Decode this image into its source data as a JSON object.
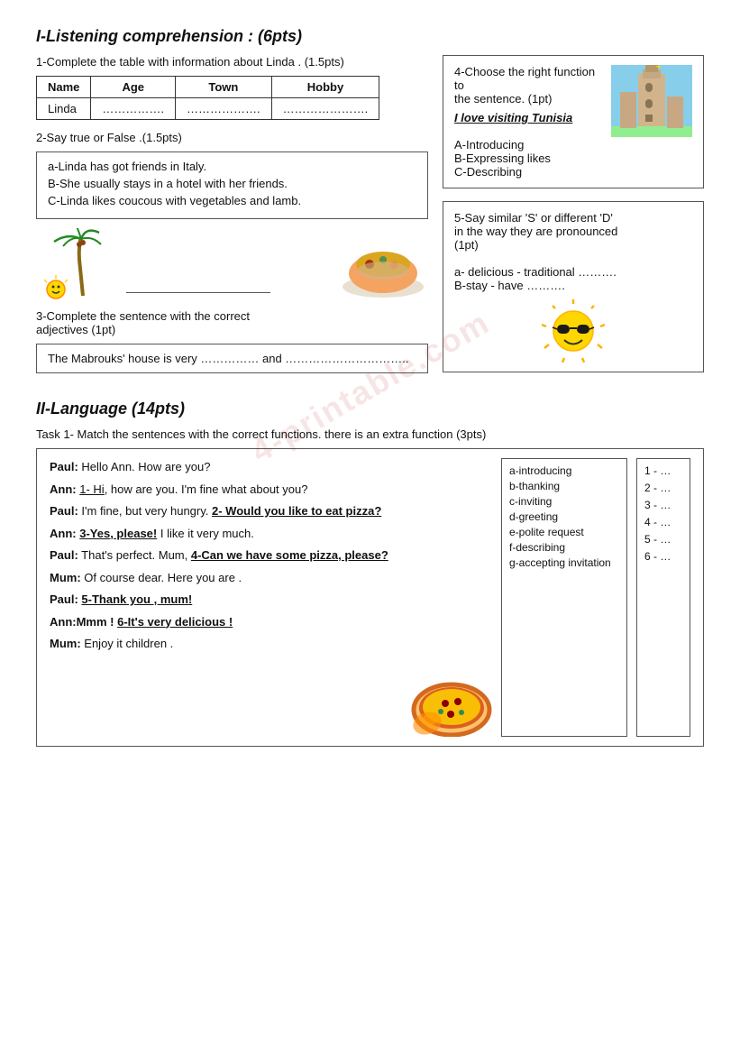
{
  "section1": {
    "title": "I-Listening comprehension : (6pts)",
    "q1": "1-Complete the table with information about Linda . (1.5pts)",
    "table": {
      "headers": [
        "Name",
        "Age",
        "Town",
        "Hobby"
      ],
      "row": [
        "Linda",
        "…………….",
        "……………….",
        "…………………."
      ]
    },
    "q2": "2-Say true or False .(1.5pts)",
    "tf_statements": [
      "a-Linda has got friends in Italy.",
      "B-She usually stays in a hotel with her friends.",
      "C-Linda likes coucous with vegetables and lamb."
    ],
    "q3_label": "3-Complete the sentence with the correct",
    "q3_label2": "adjectives (1pt)",
    "sentence": "The Mabrouks' house is very …………… and …………………………..",
    "q4_title": "4-Choose the right function to",
    "q4_title2": "the sentence. (1pt)",
    "q4_italic": "I love visiting Tunisia",
    "q4_options": [
      "A-Introducing",
      "B-Expressing likes",
      "C-Describing"
    ],
    "q5_title": "5-Say similar 'S' or different 'D'",
    "q5_title2": "in the way they are pronounced",
    "q5_pts": "(1pt)",
    "q5_a": "a- delicious   - traditional   ……….",
    "q5_b": "B-stay        - have          ………."
  },
  "section2": {
    "title": "II-Language (14pts)",
    "task1_desc": "Task 1- Match the sentences with the correct functions. there is an extra function  (3pts)",
    "dialogue": [
      {
        "speaker": "Paul:",
        "text": "Hello Ann. How are you?",
        "numbered": false,
        "bold_underline": ""
      },
      {
        "speaker": "Ann:",
        "prefix": "1- ",
        "underline_text": "Hi",
        "text": ", how are you. I'm fine what about you?"
      },
      {
        "speaker": "Paul:",
        "text": "I'm fine, but very hungry.",
        "numbered": false,
        "bold_underline": "2- Would you like to eat pizza?"
      },
      {
        "speaker": "Ann:",
        "prefix": "3-",
        "bold_underline": "Yes, please!",
        "text": "  I like it very much."
      },
      {
        "speaker": "Paul:",
        "text": "That's perfect. Mum,",
        "bold_underline": "4-Can we have some pizza, please?"
      },
      {
        "speaker": "Mum:",
        "text": "Of course dear. Here you are ."
      },
      {
        "speaker": "Paul:",
        "prefix": "5-",
        "bold_underline": "Thank you , mum!"
      },
      {
        "speaker": "Ann:Mmm !",
        "prefix": "6-",
        "bold_underline": "It's very delicious !"
      },
      {
        "speaker": "Mum:",
        "text": "Enjoy it children ."
      }
    ],
    "functions": [
      "a-introducing",
      "b-thanking",
      "c-inviting",
      "d-greeting",
      "e-polite request",
      "f-describing",
      "g-accepting invitation"
    ],
    "answers": [
      "1 - …",
      "2 - …",
      "3 - …",
      "4 - …",
      "5 - …",
      "6 - …"
    ]
  }
}
